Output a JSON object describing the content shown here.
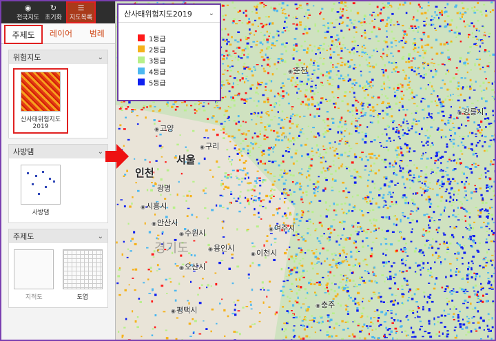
{
  "topbar": {
    "buttons": [
      {
        "label": "전국지도",
        "icon": "eye-icon"
      },
      {
        "label": "초기화",
        "icon": "refresh-icon"
      },
      {
        "label": "지도목록",
        "icon": "list-icon"
      }
    ]
  },
  "tabs": [
    "주제도",
    "레이어",
    "범례"
  ],
  "sections": {
    "risk": {
      "title": "위험지도",
      "item_label": "산사태위험지도2019"
    },
    "dam": {
      "title": "사방댐",
      "item_label": "사방댐"
    },
    "theme": {
      "title": "주제도",
      "items": [
        "지적도",
        "도엽"
      ]
    }
  },
  "legend": {
    "title": "산사태위험지도2019",
    "items": [
      {
        "label": "1등급",
        "color": "#ff1a1a"
      },
      {
        "label": "2등급",
        "color": "#f5b21b"
      },
      {
        "label": "3등급",
        "color": "#b7f08a"
      },
      {
        "label": "4등급",
        "color": "#4db8f0"
      },
      {
        "label": "5등급",
        "color": "#1020f0"
      }
    ]
  },
  "map": {
    "labels": {
      "seoul": "서울",
      "incheon": "인천",
      "goyang": "고양",
      "guri": "구리",
      "gwangmyeong": "광명",
      "siheung": "시흥시",
      "ansan": "안산시",
      "suwon": "수원시",
      "osan": "오산시",
      "yongin": "용인시",
      "pyeongtaek": "평택시",
      "yeoju": "여주시",
      "icheon": "이천시",
      "chuncheon": "춘천",
      "gangneung": "강릉시",
      "chungju": "충주",
      "gyeonggi": "경기도"
    }
  }
}
